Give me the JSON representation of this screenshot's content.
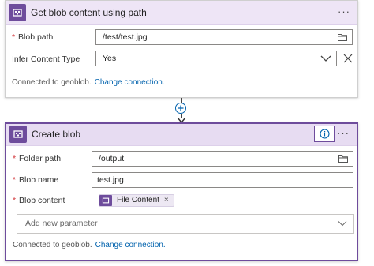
{
  "steps": [
    {
      "title": "Get blob content using path",
      "fields": [
        {
          "label": "Blob path",
          "required": true,
          "value": "/test/test.jpg"
        },
        {
          "label": "Infer Content Type",
          "required": false,
          "value": "Yes"
        }
      ],
      "connection_text": "Connected to geoblob.",
      "change_connection_label": "Change connection."
    },
    {
      "title": "Create blob",
      "fields": [
        {
          "label": "Folder path",
          "required": true,
          "value": "/output"
        },
        {
          "label": "Blob name",
          "required": true,
          "value": "test.jpg"
        },
        {
          "label": "Blob content",
          "required": true,
          "token_label": "File Content"
        }
      ],
      "add_parameter_placeholder": "Add new parameter",
      "connection_text": "Connected to geoblob.",
      "change_connection_label": "Change connection."
    }
  ],
  "symbols": {
    "more": "···",
    "required_mark": "*",
    "token_remove": "×"
  },
  "colors": {
    "connector_purple": "#6e4c9c",
    "header_tint": "#eee5f6",
    "link_blue": "#0062ad",
    "required_red": "#d13438"
  },
  "icons": [
    "blob-connector-icon",
    "folder-icon",
    "chevron-down-icon",
    "clear-icon",
    "info-icon",
    "more-icon",
    "add-step-icon",
    "arrow-down-icon"
  ]
}
